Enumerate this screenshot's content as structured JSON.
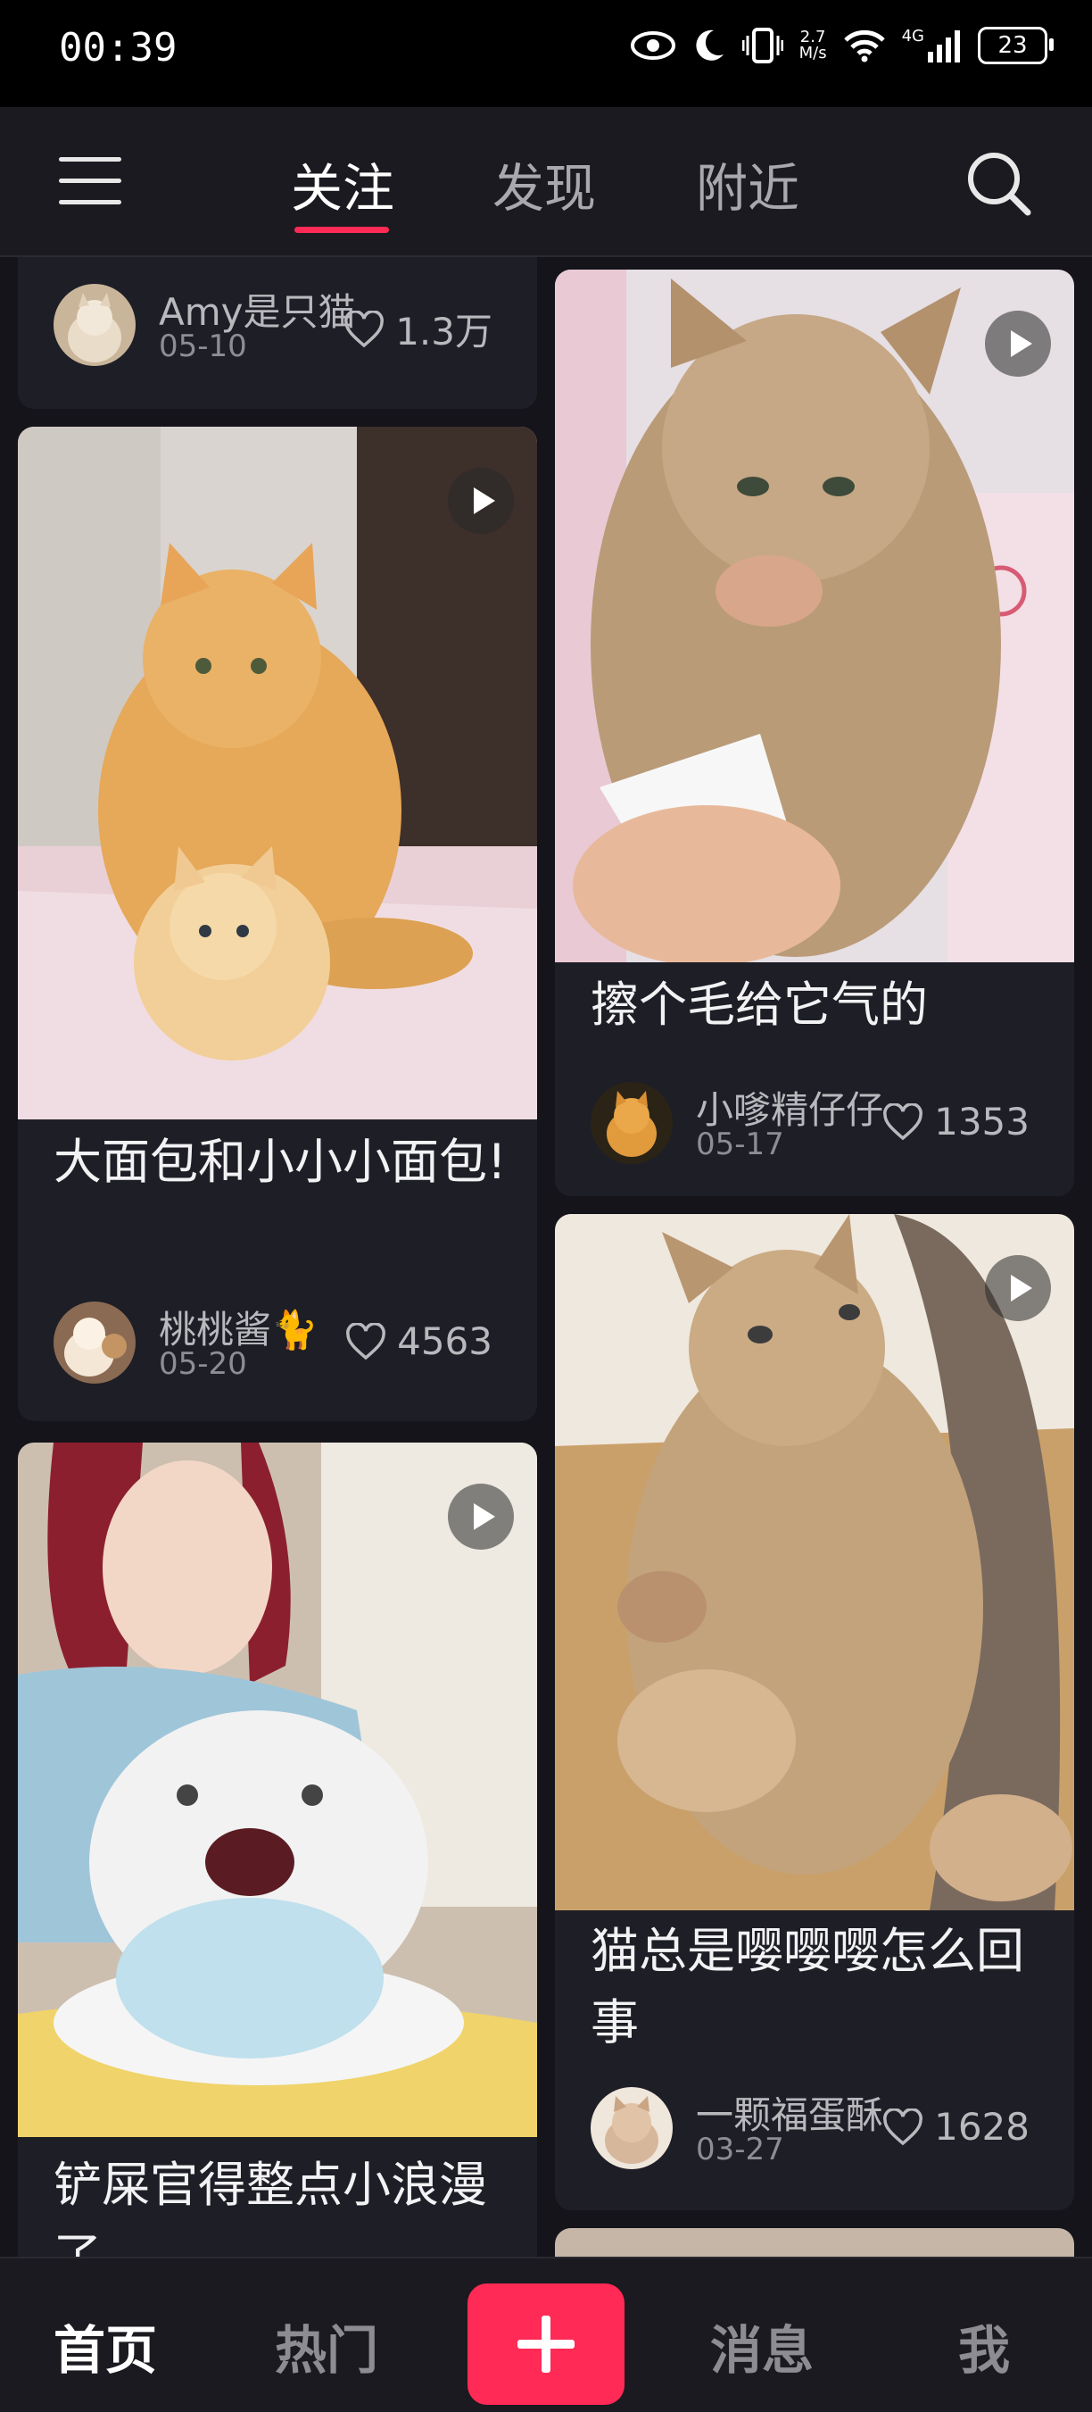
{
  "status_bar": {
    "time": "00:39",
    "net_speed_value": "2.7",
    "net_speed_unit": "M/s",
    "network_type": "4G",
    "battery": "23",
    "icons": [
      "eye-icon",
      "moon-icon",
      "vibrate-icon",
      "wifi-icon",
      "signal-icon",
      "battery-icon"
    ]
  },
  "top_nav": {
    "tabs": [
      {
        "label": "关注",
        "active": true
      },
      {
        "label": "发现",
        "active": false
      },
      {
        "label": "附近",
        "active": false
      }
    ],
    "accent_color": "#ff2a55"
  },
  "feed": {
    "posts": [
      {
        "title": "",
        "author": "Amy是只猫",
        "date": "05-10",
        "likes": "1.3万",
        "video": false
      },
      {
        "title": "大面包和小小小面包!",
        "author": "桃桃酱🐈",
        "date": "05-20",
        "likes": "4563",
        "video": true
      },
      {
        "title": "铲屎官得整点小浪漫了",
        "author": "",
        "date": "",
        "likes": "",
        "video": true
      },
      {
        "title": "擦个毛给它气的",
        "author": "小嗲精仔仔",
        "date": "05-17",
        "likes": "1353",
        "video": true
      },
      {
        "title": "猫总是嘤嘤嘤怎么回事",
        "author": "一颗福蛋酥",
        "date": "03-27",
        "likes": "1628",
        "video": true
      },
      {
        "title": "",
        "author": "",
        "date": "",
        "likes": "",
        "video": false
      }
    ]
  },
  "bottom_nav": {
    "items": [
      {
        "label": "首页",
        "active": true
      },
      {
        "label": "热门",
        "active": false
      },
      {
        "label": "消息",
        "active": false
      },
      {
        "label": "我",
        "active": false
      }
    ],
    "publish_button": "plus-icon"
  }
}
